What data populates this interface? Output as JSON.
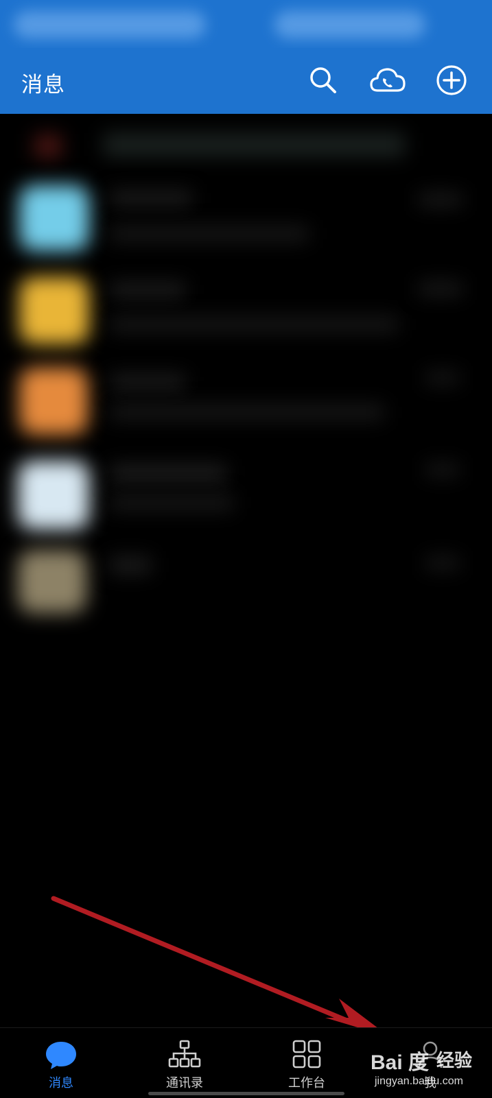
{
  "header": {
    "title": "消息",
    "actions": [
      {
        "name": "search-icon"
      },
      {
        "name": "cloud-phone-icon"
      },
      {
        "name": "add-icon"
      }
    ],
    "color": "#1e73cf"
  },
  "tabs": [
    {
      "label": "消息",
      "icon": "chat-bubble-icon",
      "active": true
    },
    {
      "label": "通讯录",
      "icon": "org-chart-icon",
      "active": false
    },
    {
      "label": "工作台",
      "icon": "grid-icon",
      "active": false
    },
    {
      "label": "我",
      "icon": "person-icon",
      "active": false
    }
  ],
  "accent_color": "#2f88ff",
  "annotation_color": "#b11c22",
  "watermark": {
    "logo": "Bai 度",
    "text": "经验",
    "url": "jingyan.baidu.com"
  }
}
